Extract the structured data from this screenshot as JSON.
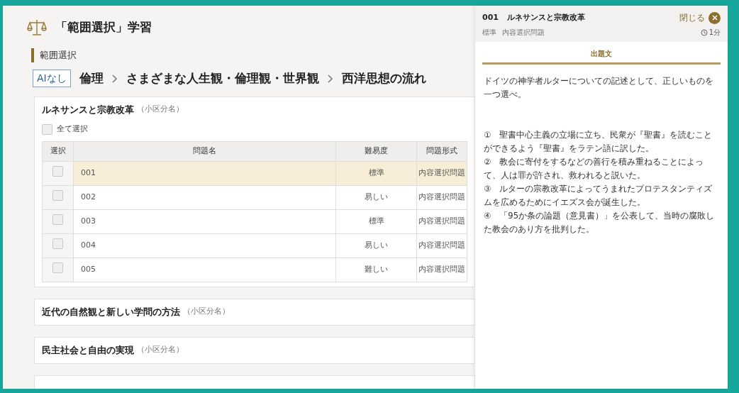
{
  "header": {
    "title": "「範囲選択」学習"
  },
  "section_label": "範囲選択",
  "breadcrumb": {
    "badge": "AIなし",
    "items": [
      "倫理",
      "さまざまな人生観・倫理観・世界観",
      "西洋思想の流れ"
    ]
  },
  "sections": [
    {
      "title": "ルネサンスと宗教改革",
      "note": "（小区分名）",
      "expanded": true,
      "select_all": {
        "label": "全て選択",
        "checked": false
      },
      "table": {
        "columns": [
          "選択",
          "問題名",
          "難易度",
          "問題形式"
        ],
        "rows": [
          {
            "name": "001",
            "difficulty": "標準",
            "format": "内容選択問題",
            "checked": false,
            "selected": true
          },
          {
            "name": "002",
            "difficulty": "易しい",
            "format": "内容選択問題",
            "checked": false,
            "selected": false
          },
          {
            "name": "003",
            "difficulty": "標準",
            "format": "内容選択問題",
            "checked": false,
            "selected": false
          },
          {
            "name": "004",
            "difficulty": "易しい",
            "format": "内容選択問題",
            "checked": false,
            "selected": false
          },
          {
            "name": "005",
            "difficulty": "難しい",
            "format": "内容選択問題",
            "checked": false,
            "selected": false
          }
        ]
      }
    },
    {
      "title": "近代の自然観と新しい学問の方法",
      "note": "（小区分名）",
      "expanded": false
    },
    {
      "title": "民主社会と自由の実現",
      "note": "（小区分名）",
      "expanded": false
    },
    {
      "expanded": false
    }
  ],
  "panel": {
    "number": "001",
    "title": "ルネサンスと宗教改革",
    "close": "閉じる",
    "difficulty": "標準",
    "format": "内容選択問題",
    "time": "1分",
    "tab": "出題文",
    "question": "ドイツの神学者ルターについての記述として、正しいものを一つ選べ。",
    "options": [
      "①　聖書中心主義の立場に立ち、民衆が『聖書』を読むことができるよう『聖書』をラテン語に訳した。",
      "②　教会に寄付をするなどの善行を積み重ねることによって、人は罪が許され、救われると説いた。",
      "③　ルターの宗教改革によってうまれたプロテスタンティズムを広めるためにイエズス会が誕生した。",
      "④　「95か条の論題（意見書）」を公表して、当時の腐敗した教会のあり方を批判した。"
    ]
  }
}
